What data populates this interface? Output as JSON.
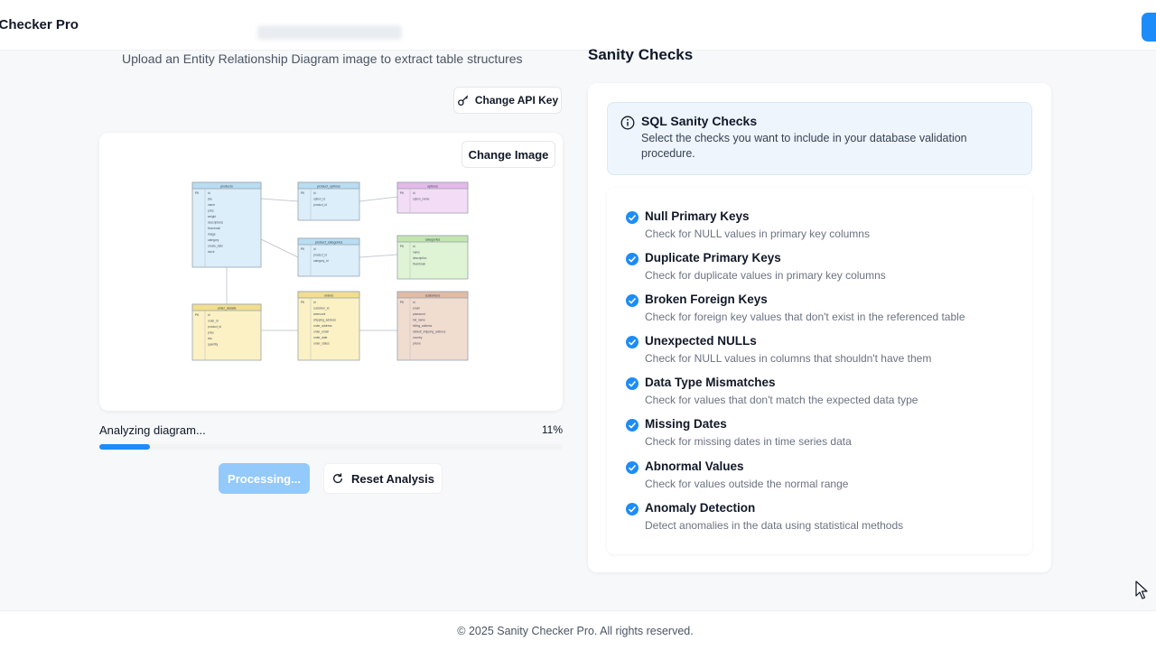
{
  "header": {
    "brand": "y Checker Pro"
  },
  "upload": {
    "subtitle": "Upload an Entity Relationship Diagram image to extract table structures",
    "change_api_key": "Change API Key",
    "change_image": "Change Image"
  },
  "progress": {
    "label": "Analyzing diagram...",
    "percent_text": "11%",
    "value": 0.11
  },
  "actions": {
    "processing": "Processing...",
    "reset": "Reset Analysis"
  },
  "checks": {
    "heading": "Sanity Checks",
    "info_title": "SQL Sanity Checks",
    "info_desc": "Select the checks you want to include in your database validation procedure.",
    "items": [
      {
        "title": "Null Primary Keys",
        "desc": "Check for NULL values in primary key columns"
      },
      {
        "title": "Duplicate Primary Keys",
        "desc": "Check for duplicate values in primary key columns"
      },
      {
        "title": "Broken Foreign Keys",
        "desc": "Check for foreign key values that don't exist in the referenced table"
      },
      {
        "title": "Unexpected NULLs",
        "desc": "Check for NULL values in columns that shouldn't have them"
      },
      {
        "title": "Data Type Mismatches",
        "desc": "Check for values that don't match the expected data type"
      },
      {
        "title": "Missing Dates",
        "desc": "Check for missing dates in time series data"
      },
      {
        "title": "Abnormal Values",
        "desc": "Check for values outside the normal range"
      },
      {
        "title": "Anomaly Detection",
        "desc": "Detect anomalies in the data using statistical methods"
      }
    ]
  },
  "erd": {
    "tables": [
      {
        "name": "products",
        "color": "#dbeefa",
        "header": "#b9ddf2",
        "rows": [
          "id",
          "sku",
          "name",
          "price",
          "weight",
          "descriptions",
          "thumbnail",
          "image",
          "category",
          "create_date",
          "stock"
        ]
      },
      {
        "name": "product_options",
        "color": "#dbeefa",
        "header": "#b9ddf2",
        "rows": [
          "id",
          "option_id",
          "product_id"
        ]
      },
      {
        "name": "options",
        "color": "#f3dcf5",
        "header": "#e5b9ea",
        "rows": [
          "id",
          "option_name"
        ]
      },
      {
        "name": "product_categories",
        "color": "#dbeefa",
        "header": "#b9ddf2",
        "rows": [
          "id",
          "product_id",
          "category_id"
        ]
      },
      {
        "name": "categories",
        "color": "#dff3d5",
        "header": "#c3e6b1",
        "rows": [
          "id",
          "name",
          "description",
          "thumbnail"
        ]
      },
      {
        "name": "order_details",
        "color": "#fbf1c4",
        "header": "#f1df8f",
        "rows": [
          "id",
          "order_id",
          "product_id",
          "price",
          "sku",
          "quantity"
        ]
      },
      {
        "name": "orders",
        "color": "#fbf1c4",
        "header": "#f1df8f",
        "rows": [
          "id",
          "customer_id",
          "ammount",
          "shipping_address",
          "order_address",
          "order_email",
          "order_date",
          "order_status"
        ]
      },
      {
        "name": "customers",
        "color": "#f1dcd0",
        "header": "#e1bba6",
        "rows": [
          "id",
          "email",
          "password",
          "full_name",
          "billing_address",
          "default_shipping_address",
          "country",
          "phone"
        ]
      }
    ],
    "pk_label": "PK"
  },
  "footer": {
    "text": "© 2025 Sanity Checker Pro. All rights reserved."
  },
  "colors": {
    "accent": "#1d8cf8",
    "accent_disabled": "#93c9fb"
  }
}
